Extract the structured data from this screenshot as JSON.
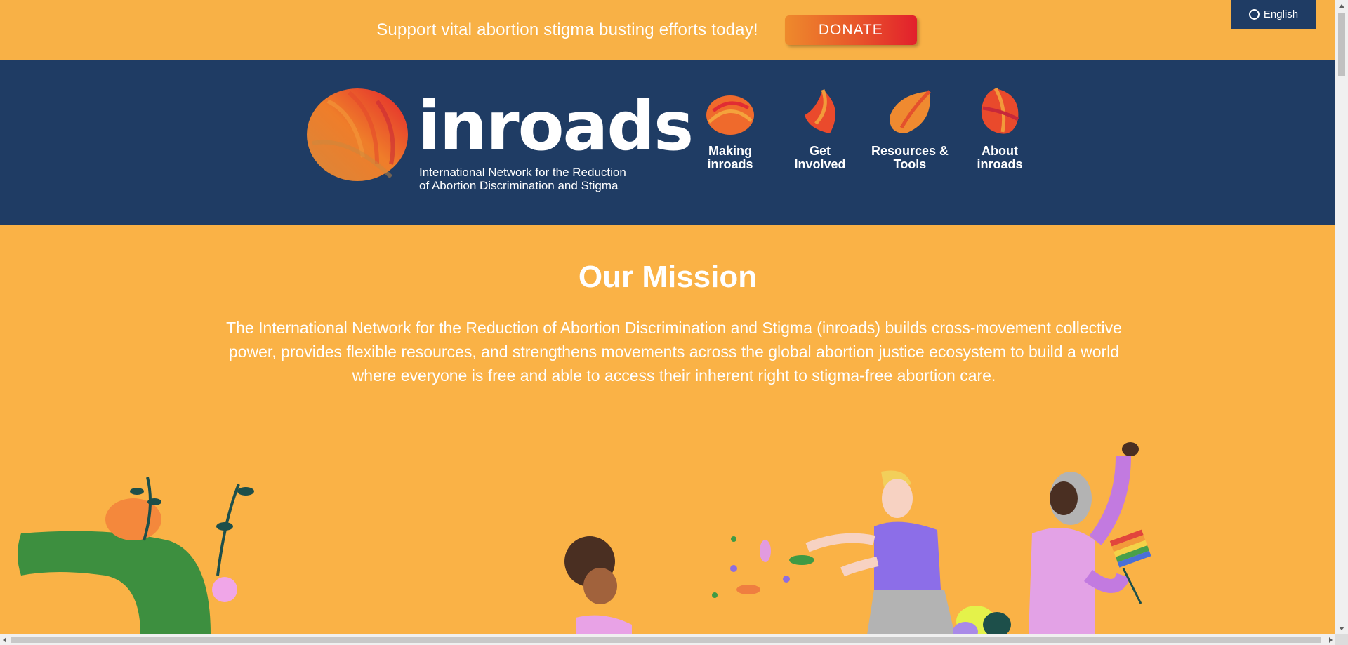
{
  "banner": {
    "text": "Support vital abortion stigma busting efforts today!",
    "donate_label": "DONATE"
  },
  "language": {
    "label": "English"
  },
  "logo": {
    "word": "inroads",
    "subtitle_line1": "International Network for the Reduction",
    "subtitle_line2": "of Abortion Discrimination and Stigma"
  },
  "nav": {
    "items": [
      {
        "line1": "Making",
        "line2": "inroads"
      },
      {
        "line1": "Get",
        "line2": "Involved"
      },
      {
        "line1": "Resources &",
        "line2": "Tools"
      },
      {
        "line1": "About",
        "line2": "inroads"
      }
    ]
  },
  "mission": {
    "title": "Our Mission",
    "text": "The International Network for the Reduction of Abortion Discrimination and Stigma (inroads) builds cross-movement collective power, provides flexible resources, and strengthens movements across the global abortion justice ecosystem to build a world where everyone is free and able to access their inherent right to stigma-free abortion care."
  },
  "colors": {
    "banner_bg": "#f8b146",
    "header_bg": "#1f3c64",
    "page_bg": "#fab246",
    "accent_red": "#e21f2c",
    "accent_orange": "#ee8a2c"
  }
}
